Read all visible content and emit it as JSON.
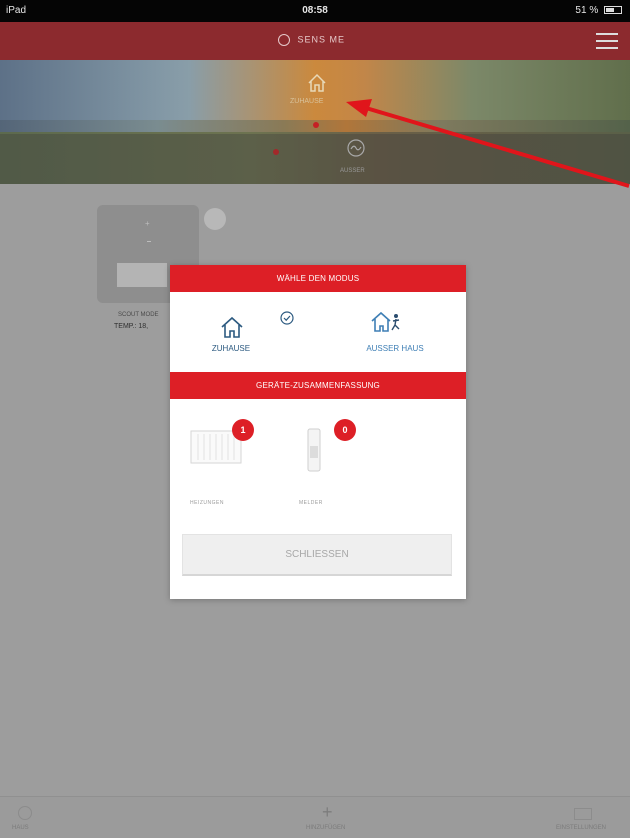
{
  "status_bar": {
    "carrier": "iPad",
    "time": "08:58",
    "battery": "51 %"
  },
  "header": {
    "logo_text": "SENS ME"
  },
  "banner": {
    "home_tab_label": "ZUHAUSE",
    "away_tab_label": "AUSSER"
  },
  "device": {
    "name": "SCOUT MODE",
    "temp": "TEMP.: 18,"
  },
  "modal": {
    "mode_header": "WÄHLE DEN MODUS",
    "home_label": "ZUHAUSE",
    "away_label": "AUSSER HAUS",
    "summary_header": "GERÄTE-ZUSAMMENFASSUNG",
    "heater_count": "1",
    "heater_label": "HEIZUNGEN",
    "sensor_count": "0",
    "sensor_label": "MELDER",
    "close_label": "SCHLIESSEN"
  },
  "bottom_nav": {
    "left_label": "HAUS",
    "center_label": "HINZUFÜGEN",
    "right_label": "EINSTELLUNGEN"
  },
  "colors": {
    "header": "#8c2a2e",
    "accent_red": "#dd1f26",
    "home_blue": "#2c5a80",
    "away_blue": "#3f7fb5",
    "overlay_gray": "#9d9d9d"
  }
}
